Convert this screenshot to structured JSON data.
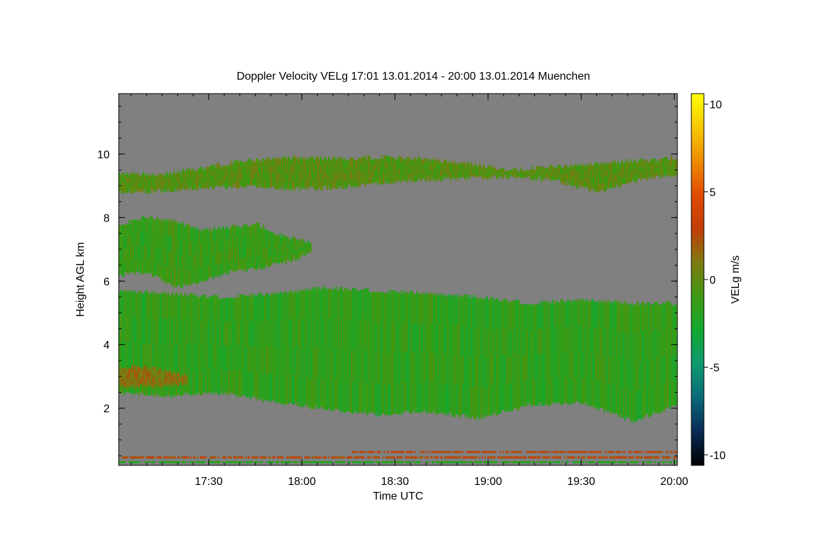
{
  "chart_data": {
    "type": "heatmap",
    "title": "Doppler Velocity VELg   17:01 13.01.2014 - 20:00 13.01.2014 Muenchen",
    "xlabel": "Time UTC",
    "ylabel": "Height AGL km",
    "colorbar_label": "VELg m/s",
    "x_range": [
      "17:01",
      "20:01"
    ],
    "x_ticks": [
      "17:30",
      "18:00",
      "18:30",
      "19:00",
      "19:30",
      "20:00"
    ],
    "x_tick_minutes": [
      30,
      60,
      90,
      120,
      150,
      180
    ],
    "x_minor_step_minutes": 5,
    "ylim": [
      0.2,
      11.9
    ],
    "y_ticks": [
      2,
      4,
      6,
      8,
      10
    ],
    "y_minor_step": 0.5,
    "clim": [
      -10.6,
      10.6
    ],
    "colorbar_ticks": [
      10,
      5,
      0,
      -5,
      -10
    ],
    "colormap": [
      "#000000",
      "#0b2a55",
      "#0a6a7a",
      "#0f9a70",
      "#12a830",
      "#3f9a12",
      "#7d7a10",
      "#c23d08",
      "#e04a00",
      "#ee8b00",
      "#f7c800",
      "#ffff00"
    ],
    "background_color": "#808080",
    "layers": [
      {
        "name": "upper cloud band",
        "velocity_ms": -0.3,
        "top_km": [
          9.4,
          9.35,
          9.6,
          9.8,
          9.9,
          9.85,
          9.9,
          9.85,
          9.7,
          9.5,
          9.6,
          9.7,
          9.8,
          9.9
        ],
        "bottom_km": [
          8.8,
          8.85,
          8.95,
          9.0,
          8.9,
          8.95,
          9.1,
          9.2,
          9.25,
          9.3,
          9.2,
          8.8,
          9.2,
          9.4
        ],
        "start_minute": 0,
        "end_minute": 182
      },
      {
        "name": "mid-level cloud",
        "velocity_ms": -1.3,
        "top_km": [
          7.8,
          8.0,
          7.9,
          7.6,
          7.7,
          7.8,
          7.4,
          7.2
        ],
        "bottom_km": [
          6.2,
          6.3,
          5.8,
          6.0,
          6.3,
          6.4,
          6.6,
          6.9
        ],
        "start_minute": 0,
        "end_minute": 62
      },
      {
        "name": "main precipitation layer",
        "velocity_ms": -1.6,
        "top_km": [
          5.7,
          5.6,
          5.5,
          5.6,
          5.8,
          5.7,
          5.6,
          5.5,
          5.3,
          5.4,
          5.3,
          5.3
        ],
        "bottom_km": [
          2.5,
          2.4,
          2.5,
          2.2,
          2.0,
          1.8,
          1.9,
          1.7,
          2.1,
          2.2,
          1.6,
          2.2
        ],
        "start_minute": 0,
        "end_minute": 182
      },
      {
        "name": "low reddish layer",
        "velocity_ms": 1.2,
        "top_km": [
          3.3,
          3.25,
          3.0
        ],
        "bottom_km": [
          2.7,
          2.7,
          2.8
        ],
        "start_minute": 0,
        "end_minute": 22
      },
      {
        "name": "ground clutter red",
        "velocity_ms": 2.5,
        "height_km": 0.45,
        "start_minute": 0,
        "end_minute": 182
      },
      {
        "name": "ground clutter green",
        "velocity_ms": -2.0,
        "height_km": 0.3,
        "start_minute": 0,
        "end_minute": 182
      },
      {
        "name": "near-surface red line",
        "velocity_ms": 2.8,
        "height_km": 0.62,
        "start_minute": 75,
        "end_minute": 182
      }
    ]
  }
}
